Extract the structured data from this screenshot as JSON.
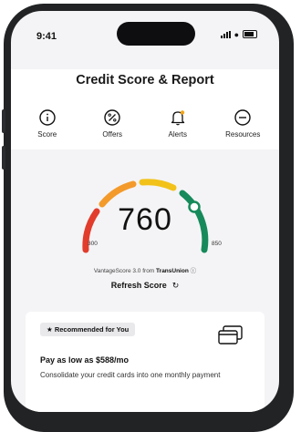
{
  "status": {
    "time": "9:41"
  },
  "header": {
    "title": "Credit Score & Report",
    "tabs": [
      {
        "label": "Score",
        "icon": "info-circle-icon"
      },
      {
        "label": "Offers",
        "icon": "percent-circle-icon"
      },
      {
        "label": "Alerts",
        "icon": "bell-icon"
      },
      {
        "label": "Resources",
        "icon": "minus-circle-icon"
      }
    ]
  },
  "score": {
    "value": "760",
    "min": "300",
    "max": "850",
    "source_prefix": "VantageScore 3.0 from",
    "source_brand": "TransUnion",
    "refresh_label": "Refresh Score",
    "colors": {
      "red": "#e23c2c",
      "orange": "#f39a2b",
      "yellow": "#f2c21a",
      "green": "#168a5a"
    }
  },
  "card": {
    "badge": "Recommended for You",
    "heading": "Pay as low as $588/mo",
    "text": "Consolidate your credit cards into one monthly payment"
  }
}
